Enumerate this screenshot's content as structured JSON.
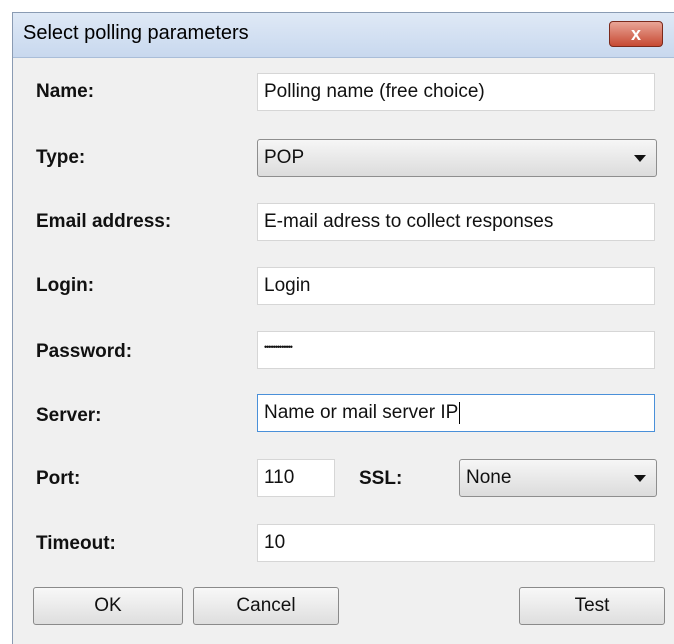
{
  "window": {
    "title": "Select polling parameters",
    "close_glyph": "x"
  },
  "fields": {
    "name": {
      "label": "Name:",
      "value": "Polling name (free choice)"
    },
    "type": {
      "label": "Type:",
      "value": "POP"
    },
    "email": {
      "label": "Email address:",
      "value": "E-mail adress to collect responses"
    },
    "login": {
      "label": "Login:",
      "value": "Login"
    },
    "password": {
      "label": "Password:",
      "value": "•••••••••••••"
    },
    "server": {
      "label": "Server:",
      "value": "Name or mail server IP"
    },
    "port": {
      "label": "Port:",
      "value": "110"
    },
    "ssl": {
      "label": "SSL:",
      "value": "None"
    },
    "timeout": {
      "label": "Timeout:",
      "value": "10"
    }
  },
  "buttons": {
    "ok": "OK",
    "cancel": "Cancel",
    "test": "Test"
  }
}
